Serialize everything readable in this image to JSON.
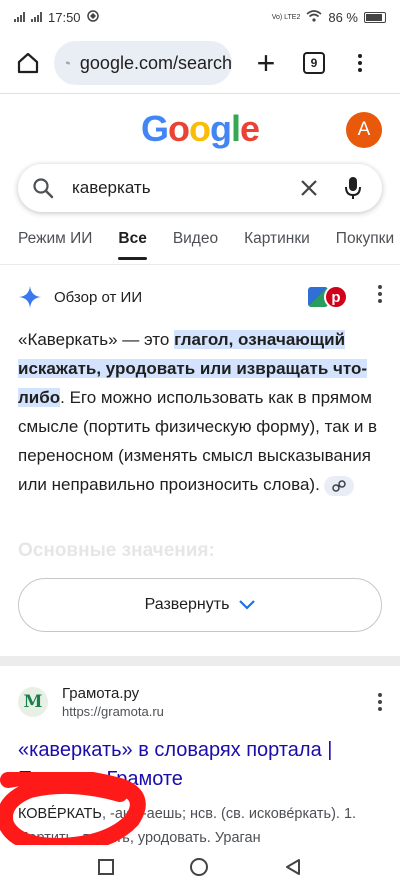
{
  "status": {
    "time": "17:50",
    "battery": "86 %",
    "lte": "Vo) LTE2"
  },
  "browser": {
    "url": "google.com/search",
    "tab_count": "9"
  },
  "header": {
    "logo": "Google",
    "avatar_letter": "A"
  },
  "search": {
    "query": "каверкать"
  },
  "filters": [
    "Режим ИИ",
    "Все",
    "Видео",
    "Картинки",
    "Покупки"
  ],
  "ai_overview": {
    "title": "Обзор от ИИ",
    "text_before": "«Каверкать» — это ",
    "text_highlight": "глагол, означающий искажать, уродовать или извращать что-либо",
    "text_after": ". Его можно использовать как в прямом смысле (портить физическую форму), так и в переносном (изменять смысл высказывания или неправильно произносить слова).",
    "faded_heading": "Основные значения:",
    "expand_label": "Развернуть"
  },
  "result": {
    "site_name": "Грамота.ру",
    "site_url": "https://gramota.ru",
    "favicon_letter": "М",
    "title": "«каверкать» в словарях портала | Поиск по Грамоте",
    "snippet_head": "КОВЕ́РКАТЬ",
    "snippet_rest": ", -аю, -аешь; нсв. (св. искове́ркать). 1. Портить, ломать, уродовать. Ураган"
  },
  "colors": {
    "accent_blue": "#1a0dab",
    "highlight": "#d3e3fd",
    "avatar": "#e8590c",
    "scribble": "#ff1a1a"
  }
}
